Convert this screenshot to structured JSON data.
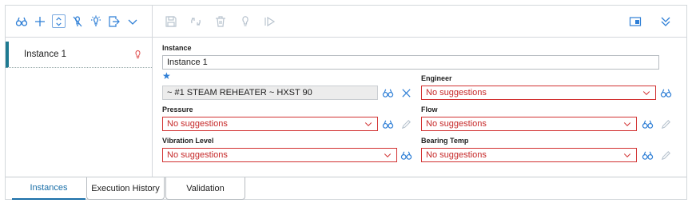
{
  "instances": [
    {
      "name": "Instance 1"
    }
  ],
  "form": {
    "instance_label": "Instance",
    "instance_value": "Instance 1",
    "asset_value": "~ #1 STEAM REHEATER ~ HXST 90",
    "engineer_label": "Engineer",
    "engineer_value": "No suggestions",
    "pressure_label": "Pressure",
    "pressure_value": "No suggestions",
    "flow_label": "Flow",
    "flow_value": "No suggestions",
    "vibration_label": "Vibration Level",
    "vibration_value": "No suggestions",
    "bearing_label": "Bearing Temp",
    "bearing_value": "No suggestions"
  },
  "tabs": [
    {
      "label": "Instances",
      "active": true
    },
    {
      "label": "Execution History",
      "active": false
    },
    {
      "label": "Validation",
      "active": false
    }
  ],
  "colors": {
    "accent": "#1e7a91",
    "icon_blue": "#2f7fd6",
    "error": "#d23232",
    "bulb": "#e05050",
    "disabled": "#b9c4cf"
  },
  "icons": {
    "left_toolbar": [
      "binoculars-icon",
      "plus-icon",
      "collapse-toggle-icon",
      "clear-filter-icon",
      "bulb-settings-icon",
      "export-icon",
      "chevron-down-icon"
    ],
    "right_toolbar": [
      "save-icon",
      "reset-icon",
      "delete-icon",
      "bulb-icon",
      "run-icon",
      "panel-icon",
      "double-chevron-down-icon"
    ]
  }
}
